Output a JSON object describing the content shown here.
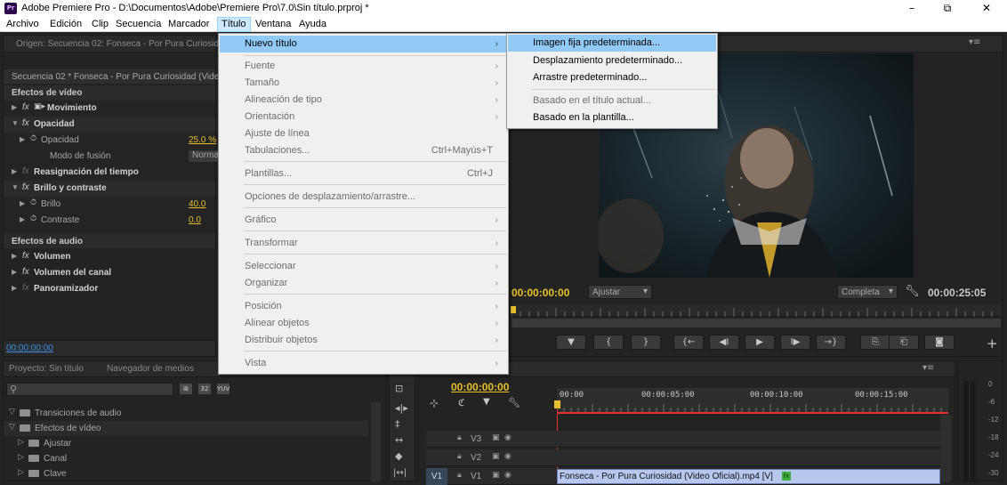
{
  "window": {
    "app_icon": "Pr",
    "title": "Adobe Premiere Pro - D:\\Documentos\\Adobe\\Premiere Pro\\7.0\\Sin título.prproj *",
    "minimize": "–",
    "maximize": "⧉",
    "close": "✕"
  },
  "menubar": [
    "Archivo",
    "Edición",
    "Clip",
    "Secuencia",
    "Marcador",
    "Título",
    "Ventana",
    "Ayuda"
  ],
  "title_menu": {
    "items": [
      {
        "label": "Nuevo título",
        "shortcut": "",
        "submenu": true,
        "enabled": true,
        "highlighted": true
      },
      {
        "label": "Fuente",
        "shortcut": "",
        "submenu": true,
        "enabled": false
      },
      {
        "label": "Tamaño",
        "shortcut": "",
        "submenu": true,
        "enabled": false
      },
      {
        "label": "Alineación de tipo",
        "shortcut": "",
        "submenu": true,
        "enabled": false
      },
      {
        "label": "Orientación",
        "shortcut": "",
        "submenu": true,
        "enabled": false
      },
      {
        "label": "Ajuste de línea",
        "shortcut": "",
        "submenu": false,
        "enabled": false
      },
      {
        "label": "Tabulaciones...",
        "shortcut": "Ctrl+Mayús+T",
        "submenu": false,
        "enabled": false
      },
      {
        "label": "Plantillas...",
        "shortcut": "Ctrl+J",
        "submenu": false,
        "enabled": false
      },
      {
        "label": "Opciones de desplazamiento/arrastre...",
        "shortcut": "",
        "submenu": false,
        "enabled": false
      },
      {
        "label": "Gráfico",
        "shortcut": "",
        "submenu": true,
        "enabled": false
      },
      {
        "label": "Transformar",
        "shortcut": "",
        "submenu": true,
        "enabled": false
      },
      {
        "label": "Seleccionar",
        "shortcut": "",
        "submenu": true,
        "enabled": false
      },
      {
        "label": "Organizar",
        "shortcut": "",
        "submenu": true,
        "enabled": false
      },
      {
        "label": "Posición",
        "shortcut": "",
        "submenu": true,
        "enabled": false
      },
      {
        "label": "Alinear objetos",
        "shortcut": "",
        "submenu": true,
        "enabled": false
      },
      {
        "label": "Distribuir objetos",
        "shortcut": "",
        "submenu": true,
        "enabled": false
      },
      {
        "label": "Vista",
        "shortcut": "",
        "submenu": true,
        "enabled": false
      }
    ]
  },
  "new_title_submenu": {
    "items": [
      {
        "label": "Imagen fija predeterminada...",
        "enabled": true,
        "highlighted": true
      },
      {
        "label": "Desplazamiento predeterminado...",
        "enabled": true
      },
      {
        "label": "Arrastre predeterminado...",
        "enabled": true
      },
      {
        "label": "Basado en el título actual...",
        "enabled": false
      },
      {
        "label": "Basado en la plantilla...",
        "enabled": true
      }
    ]
  },
  "source_panel": {
    "tab": "Origen: Secuencia 02: Fonseca - Por Pura Curiosid"
  },
  "effect_controls": {
    "sequence_label": "Secuencia 02 * Fonseca - Por Pura Curiosidad (Vide",
    "video_effects_header": "Efectos de vídeo",
    "rows": [
      {
        "arrow": "▶",
        "fx": "fx",
        "label": "Movimiento",
        "value": ""
      },
      {
        "arrow": "▼",
        "fx": "fx",
        "label": "Opacidad",
        "value": ""
      },
      {
        "arrow": "▶",
        "fx": "",
        "label": "Opacidad",
        "value": "25.0 %"
      },
      {
        "arrow": "",
        "fx": "",
        "label": "Modo de fusión",
        "value": "Norma"
      },
      {
        "arrow": "▶",
        "fx": "fx",
        "label": "Reasignación del tiempo",
        "value": ""
      },
      {
        "arrow": "▼",
        "fx": "fx",
        "label": "Brillo y contraste",
        "value": ""
      },
      {
        "arrow": "▶",
        "fx": "",
        "label": "Brillo",
        "value": "40.0"
      },
      {
        "arrow": "▶",
        "fx": "",
        "label": "Contraste",
        "value": "0.0"
      }
    ],
    "audio_effects_header": "Efectos de audio",
    "audio_rows": [
      {
        "arrow": "▶",
        "fx": "fx",
        "label": "Volumen"
      },
      {
        "arrow": "▶",
        "fx": "fx",
        "label": "Volumen del canal"
      },
      {
        "arrow": "▶",
        "fx": "fx",
        "label": "Panoramizador"
      }
    ],
    "timecode": "00:00:00:00"
  },
  "program_monitor": {
    "timecode_left": "00:00:00:00",
    "fit_label": "Ajustar",
    "quality_label": "Completa",
    "timecode_right": "00:00:25:05",
    "transport": [
      "▼",
      "{",
      "}",
      "{←",
      "◀I",
      "▶",
      "I▶",
      "→}",
      "⎘",
      "⎗",
      "◙"
    ],
    "add": "+"
  },
  "project_panel": {
    "tabs": [
      "Proyecto: Sin título",
      "Navegador de medios"
    ],
    "search_placeholder": "",
    "tree": [
      {
        "expanded": true,
        "label": "Transiciones de audio",
        "indent": 0
      },
      {
        "expanded": true,
        "label": "Efectos de vídeo",
        "indent": 0
      },
      {
        "expanded": false,
        "label": "Ajustar",
        "indent": 1
      },
      {
        "expanded": false,
        "label": "Canal",
        "indent": 1
      },
      {
        "expanded": false,
        "label": "Clave",
        "indent": 1
      }
    ]
  },
  "timeline": {
    "timecode": "00:00:00:00",
    "ruler": [
      "00:00",
      "00:00:05:00",
      "00:00:10:00",
      "00:00:15:00"
    ],
    "tracks": [
      {
        "name": "V3",
        "clip": ""
      },
      {
        "name": "V2",
        "clip": ""
      },
      {
        "name": "V1",
        "clip": "Fonseca - Por Pura Curiosidad (Video Oficial).mp4 [V]",
        "target": "V1"
      }
    ]
  },
  "audio_meter": {
    "labels": [
      "0",
      "-6",
      "-12",
      "-18",
      "-24",
      "-30"
    ]
  },
  "colors": {
    "accent_blue": "#3d8fe6",
    "timecode_yellow": "#e8c02c",
    "playhead_red": "#e8322c",
    "menu_highlight": "#91c9f7"
  }
}
